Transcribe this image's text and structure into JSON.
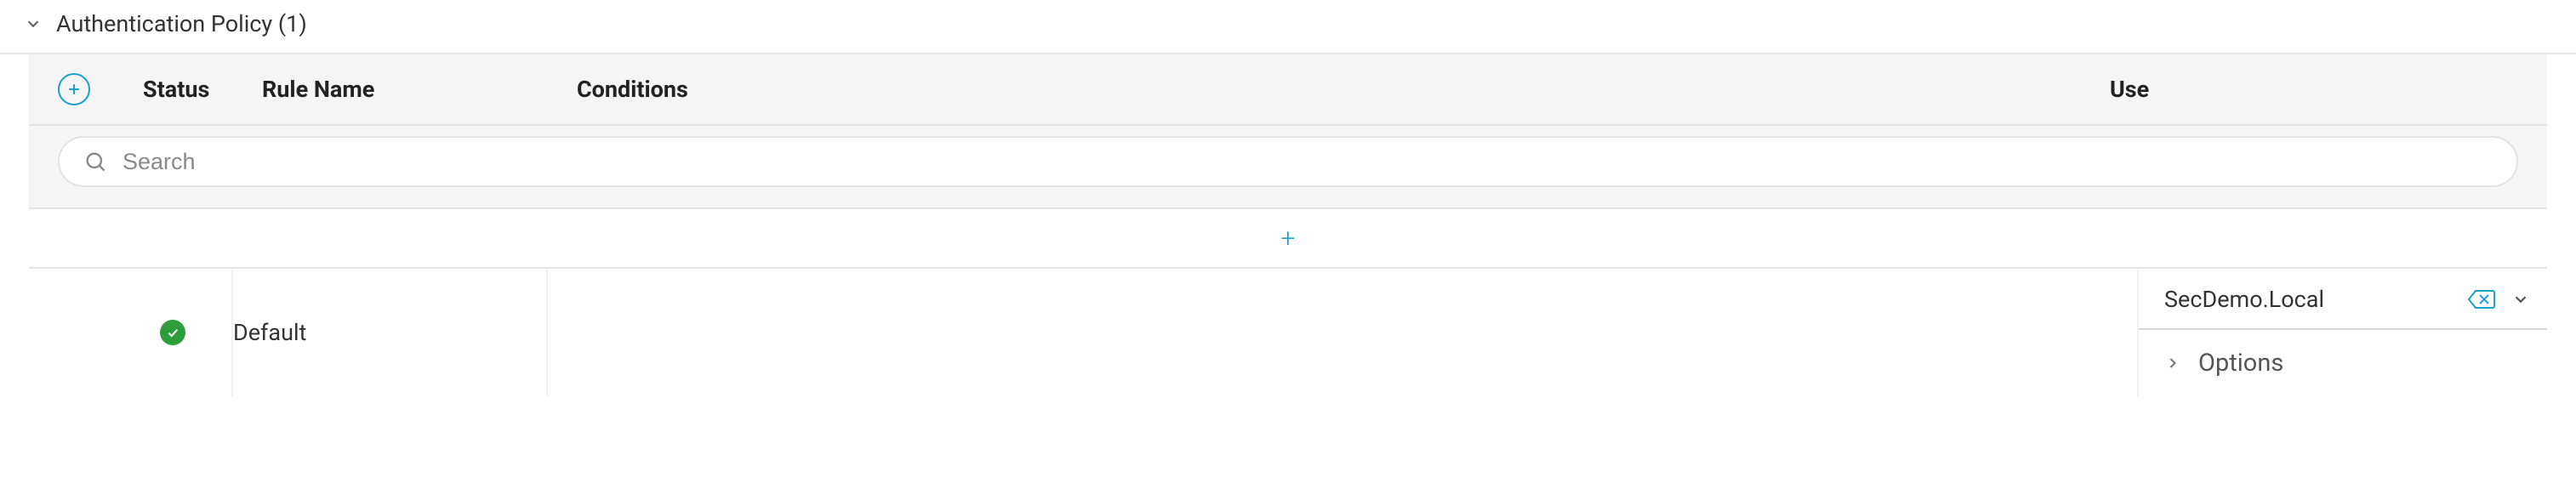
{
  "section": {
    "title": "Authentication Policy (1)"
  },
  "headers": {
    "status": "Status",
    "rule_name": "Rule Name",
    "conditions": "Conditions",
    "use": "Use"
  },
  "search": {
    "placeholder": "Search",
    "value": ""
  },
  "row": {
    "rule_name": "Default",
    "use_value": "SecDemo.Local",
    "options_label": "Options"
  }
}
